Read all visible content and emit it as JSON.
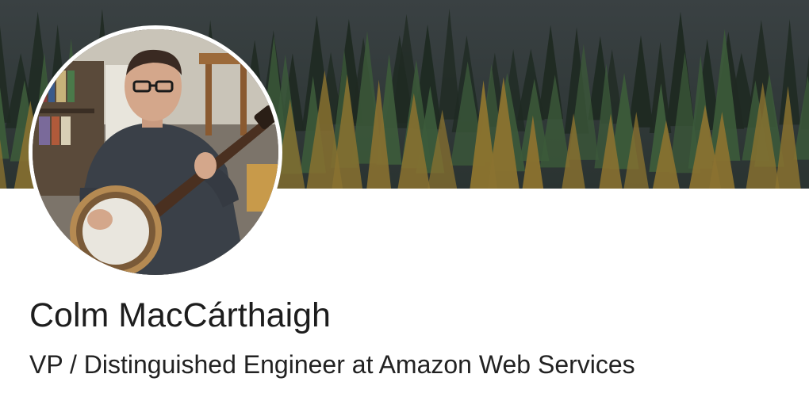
{
  "profile": {
    "name": "Colm MacCárthaigh",
    "headline": "VP / Distinguished Engineer at Amazon Web Services"
  },
  "images": {
    "cover_icon": "forest-cover-photo",
    "avatar_icon": "person-playing-banjo-photo"
  },
  "colors": {
    "cover_sky": "#2b3033",
    "tree_dark": "#1f2a22",
    "tree_green": "#3c5a3a",
    "tree_gold": "#8a7230",
    "name_text": "#1d1d1d",
    "headline_text": "#222222"
  }
}
